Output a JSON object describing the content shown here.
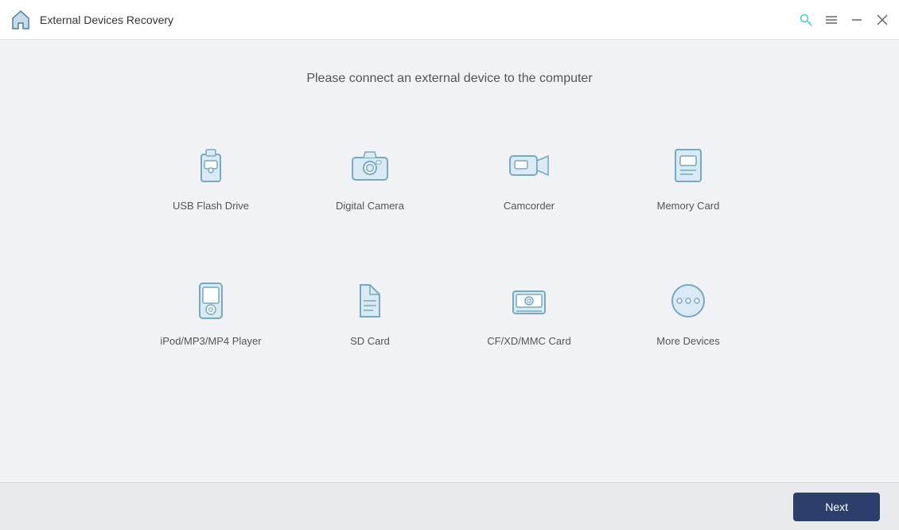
{
  "titlebar": {
    "title": "External Devices Recovery",
    "logo_icon": "house-icon",
    "key_icon": "key-icon",
    "menu_icon": "menu-icon",
    "minimize_icon": "minimize-icon",
    "close_icon": "close-icon"
  },
  "main": {
    "subtitle": "Please connect an external device to the computer",
    "devices": [
      {
        "id": "usb-flash-drive",
        "label": "USB Flash Drive"
      },
      {
        "id": "digital-camera",
        "label": "Digital Camera"
      },
      {
        "id": "camcorder",
        "label": "Camcorder"
      },
      {
        "id": "memory-card",
        "label": "Memory Card"
      },
      {
        "id": "ipod-mp3-mp4",
        "label": "iPod/MP3/MP4 Player"
      },
      {
        "id": "sd-card",
        "label": "SD Card"
      },
      {
        "id": "cf-xd-mmc",
        "label": "CF/XD/MMC Card"
      },
      {
        "id": "more-devices",
        "label": "More Devices"
      }
    ]
  },
  "footer": {
    "next_label": "Next"
  }
}
